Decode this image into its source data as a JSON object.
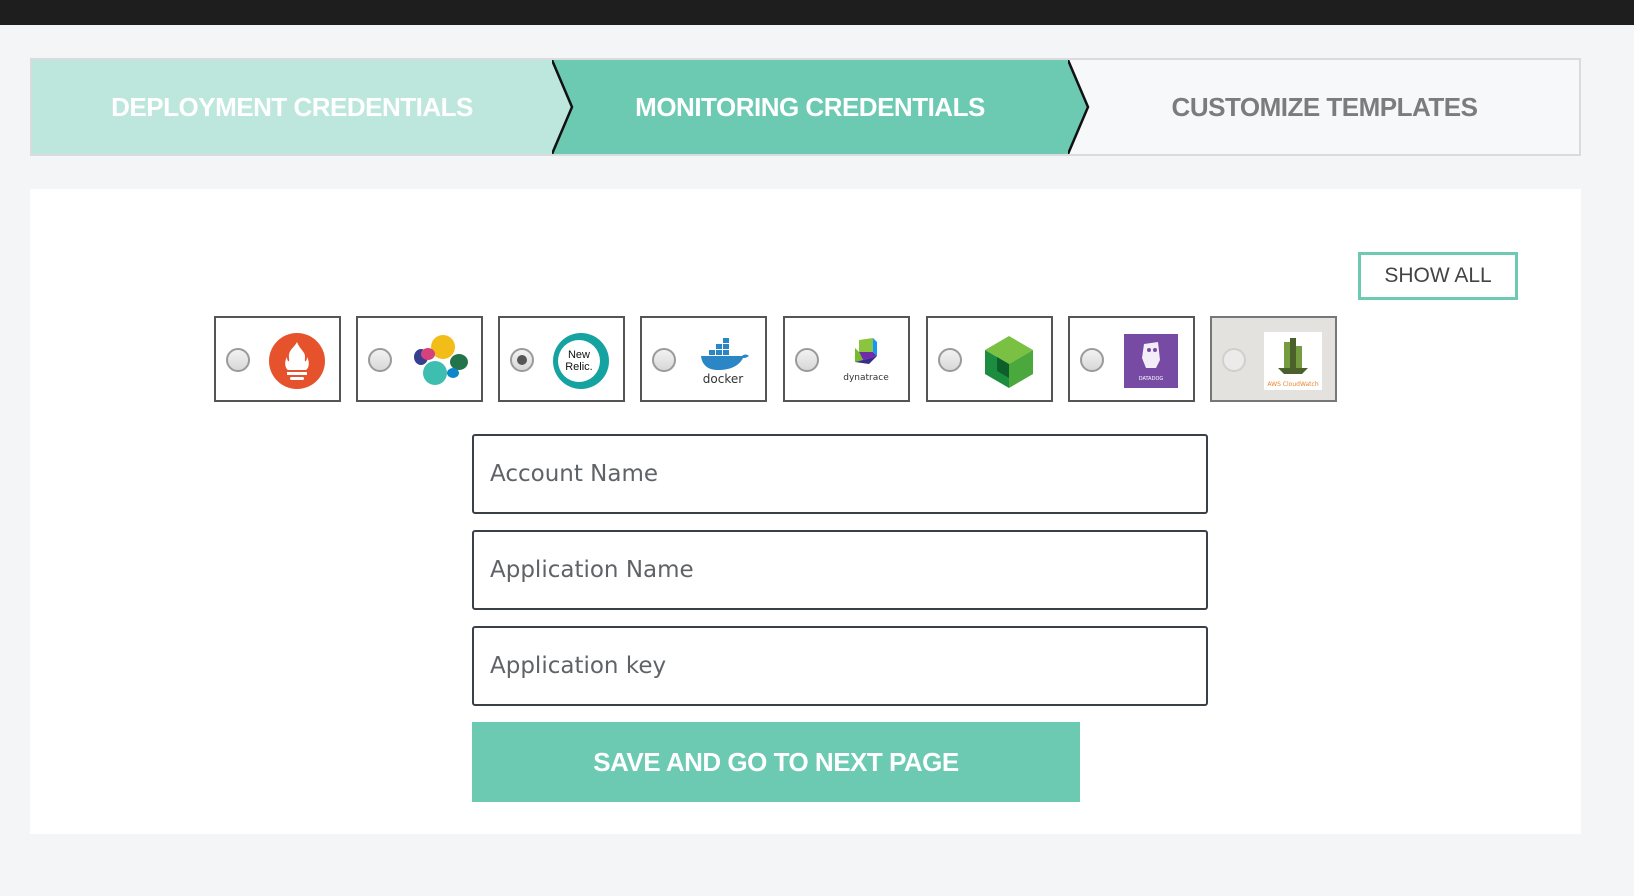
{
  "stepper": {
    "steps": [
      {
        "label": "DEPLOYMENT CREDENTIALS",
        "state": "completed"
      },
      {
        "label": "MONITORING CREDENTIALS",
        "state": "active"
      },
      {
        "label": "CUSTOMIZE TEMPLATES",
        "state": "upcoming"
      }
    ]
  },
  "colors": {
    "accent": "#6cc9b2",
    "accent_light": "#bde7dd",
    "topbar": "#1e1e1e"
  },
  "show_all_label": "SHOW ALL",
  "providers": [
    {
      "icon": "prometheus-icon",
      "selected": false,
      "enabled": true
    },
    {
      "icon": "elastic-icon",
      "selected": false,
      "enabled": true
    },
    {
      "icon": "new-relic-icon",
      "logo_text": "New Relic.",
      "selected": true,
      "enabled": true
    },
    {
      "icon": "docker-icon",
      "logo_text": "docker",
      "selected": false,
      "enabled": true
    },
    {
      "icon": "dynatrace-icon",
      "logo_text": "dynatrace",
      "selected": false,
      "enabled": true
    },
    {
      "icon": "green-cube-icon",
      "selected": false,
      "enabled": true
    },
    {
      "icon": "datadog-icon",
      "logo_text": "DATADOG",
      "selected": false,
      "enabled": true
    },
    {
      "icon": "aws-cloudwatch-icon",
      "logo_text": "AWS CloudWatch",
      "selected": false,
      "enabled": false
    }
  ],
  "form": {
    "account_name": {
      "value": "",
      "placeholder": "Account Name"
    },
    "application_name": {
      "value": "",
      "placeholder": "Application Name"
    },
    "application_key": {
      "value": "",
      "placeholder": "Application key"
    }
  },
  "save_label": "SAVE AND GO TO NEXT PAGE"
}
